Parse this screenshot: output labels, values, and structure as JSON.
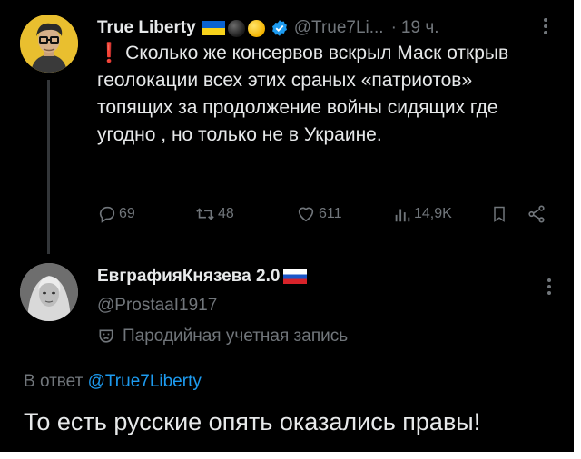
{
  "tweet": {
    "author_name": "True Liberty",
    "handle": "@True7Li...",
    "separator": "·",
    "time": "19 ч.",
    "text": "Сколько же консервов вскрыл Маск открыв геолокации всех этих сраных «патриотов» топящих за продолжение войны сидящих где угодно , но только не в Украине.",
    "icons": [
      "avatar",
      "ukraine-flag",
      "black-circle",
      "yellow-circle",
      "verified-badge",
      "more-icon",
      "red-exclamation"
    ],
    "actions": {
      "replies": "69",
      "reposts": "48",
      "likes": "611",
      "views": "14,9K"
    },
    "action_icons": [
      "reply-icon",
      "repost-icon",
      "like-icon",
      "views-icon",
      "bookmark-icon",
      "share-icon"
    ]
  },
  "reply": {
    "author_name": "ЕвграфияКнязева 2.0",
    "handle": "@ProstaaI1917",
    "parody_label": "Пародийная учетная запись",
    "reply_prefix": "В ответ",
    "reply_mention": "@True7Liberty",
    "text": "То есть русские опять оказались правы!",
    "icons": [
      "avatar",
      "russia-flag",
      "theater-mask-icon",
      "more-icon"
    ]
  },
  "colors": {
    "background": "#000000",
    "text": "#e7e9ea",
    "secondary": "#71767b",
    "link": "#1d9bf0",
    "verified": "#1d9bf0",
    "exclamation": "#e0245e"
  }
}
